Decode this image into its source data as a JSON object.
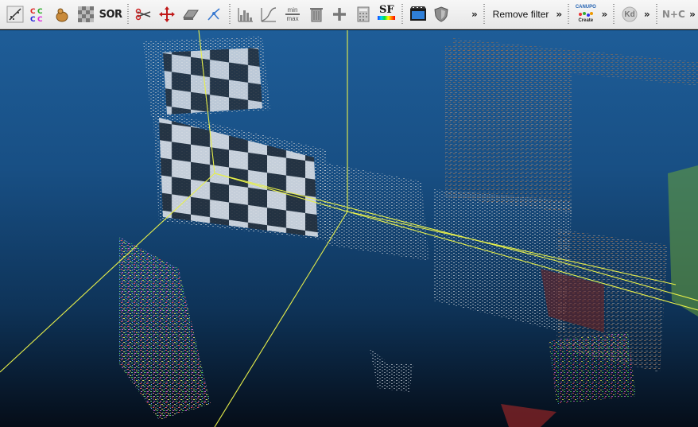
{
  "toolbar": {
    "buttons": [
      {
        "name": "sample-points-icon"
      },
      {
        "name": "cc-colors-icon",
        "text": "CC\nCC"
      },
      {
        "name": "poisson-bag-icon"
      },
      {
        "name": "noise-checker-icon"
      },
      {
        "name": "sor-filter-icon",
        "text": "SOR"
      },
      {
        "name": "scissors-icon"
      },
      {
        "name": "translate-icon"
      },
      {
        "name": "plane-icon"
      },
      {
        "name": "scatter-icon"
      },
      {
        "name": "histogram-icon"
      },
      {
        "name": "curve-icon"
      },
      {
        "name": "min-max-icon",
        "text_top": "min",
        "text_bottom": "max"
      },
      {
        "name": "delete-sf-icon"
      },
      {
        "name": "add-sf-icon"
      },
      {
        "name": "calculator-icon"
      },
      {
        "name": "scalar-field-icon",
        "text": "SF"
      },
      {
        "name": "video-icon"
      },
      {
        "name": "shield-icon"
      }
    ],
    "chevron": "»",
    "remove_filter_label": "Remove filter",
    "canupo": {
      "top": "CANUPO",
      "bottom": "Create"
    },
    "kd_label": "Kd",
    "nc_label": "N+C"
  },
  "viewport": {
    "background_top": "#1e5d98",
    "background_bottom": "#050d18",
    "bbox_color": "#e8f04a"
  }
}
